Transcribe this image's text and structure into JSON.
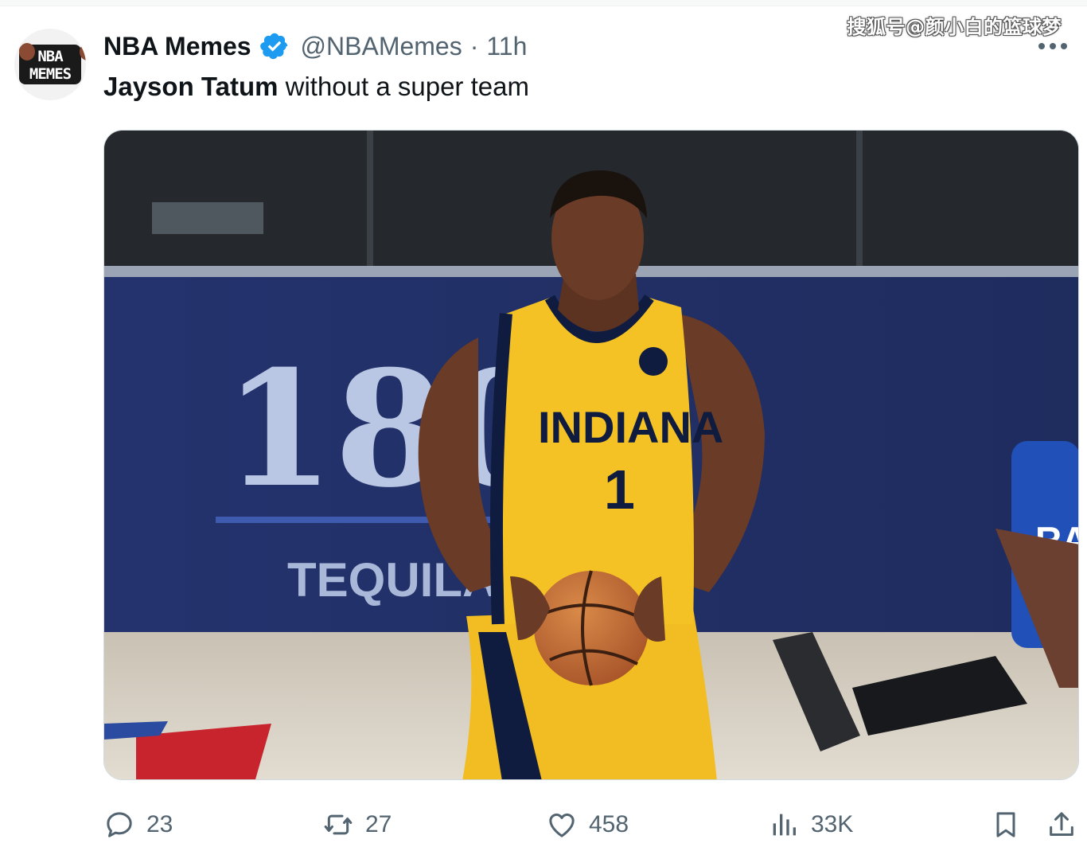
{
  "watermark": "搜狐号@颜小白的篮球梦",
  "tweet": {
    "avatar_text_line1": "NBA",
    "avatar_text_line2": "MEMES",
    "display_name": "NBA Memes",
    "verified": true,
    "handle": "@NBAMemes",
    "separator": "·",
    "time": "11h",
    "text_bold": "Jayson Tatum",
    "text_rest": " without a super team",
    "more_icon": "more-horizontal-icon"
  },
  "media": {
    "jersey_team": "INDIANA",
    "jersey_number": "1",
    "board_text": "180",
    "board_subtext": "TEQUILA",
    "opponent_jersey_text": "RAL",
    "colors": {
      "jersey_yellow": "#f5c225",
      "jersey_navy": "#0f1c3f",
      "board_blue": "#2b3a78",
      "floor": "#d9d2c6"
    }
  },
  "actions": {
    "reply": {
      "icon": "reply-icon",
      "count": "23"
    },
    "retweet": {
      "icon": "retweet-icon",
      "count": "27"
    },
    "like": {
      "icon": "heart-icon",
      "count": "458"
    },
    "views": {
      "icon": "views-icon",
      "count": "33K"
    },
    "bookmark": {
      "icon": "bookmark-icon"
    },
    "share": {
      "icon": "share-icon"
    }
  },
  "colors": {
    "verified_blue": "#1d9bf0",
    "secondary_text": "#536471",
    "primary_text": "#0f1419"
  }
}
